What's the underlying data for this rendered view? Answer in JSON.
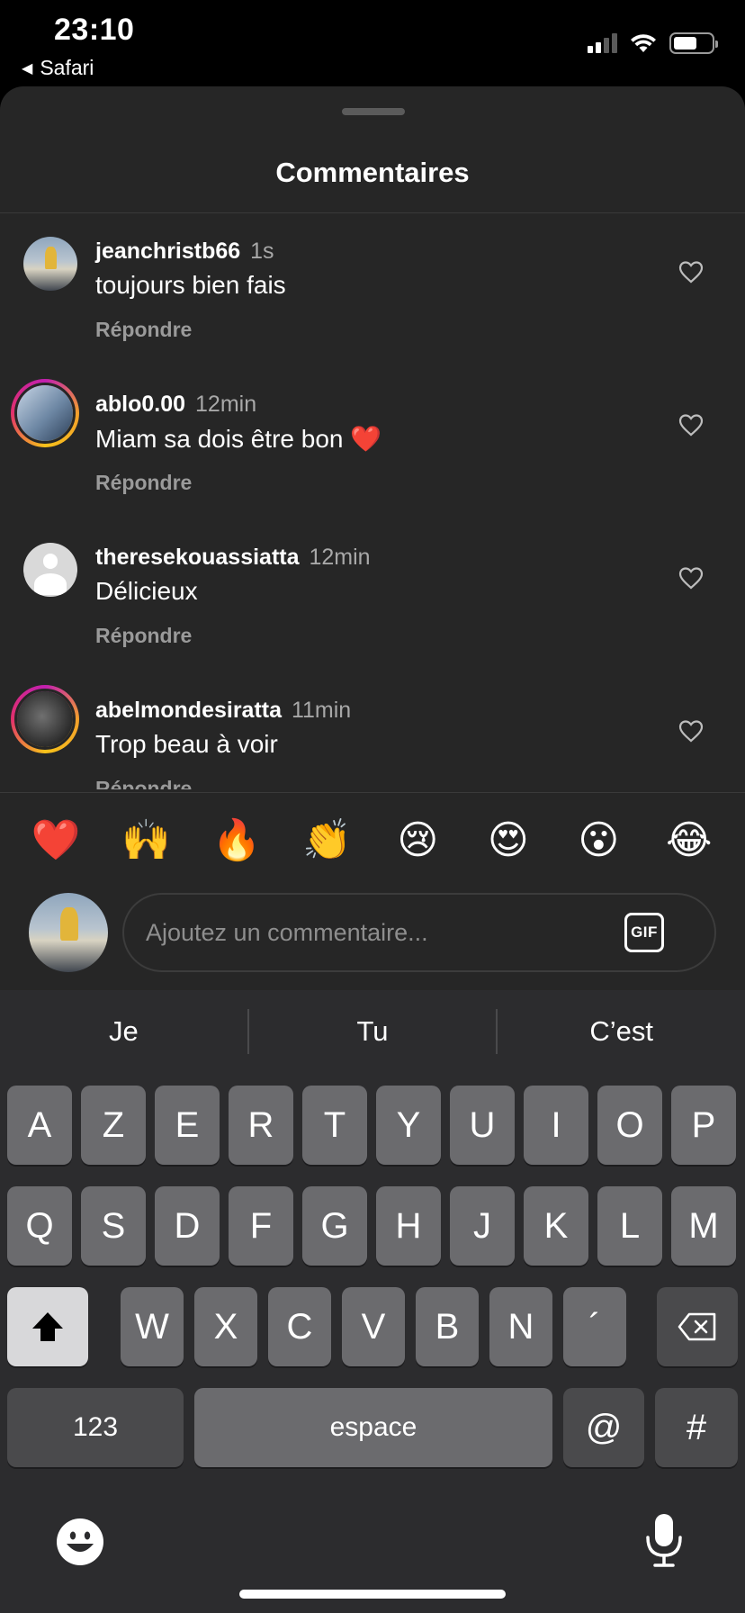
{
  "status_bar": {
    "time": "23:10",
    "back_app": "Safari"
  },
  "sheet": {
    "title": "Commentaires"
  },
  "comments": [
    {
      "user": "jeanchristb66",
      "time": "1s",
      "text": "toujours bien fais",
      "reply": "Répondre"
    },
    {
      "user": "ablo0.00",
      "time": "12min",
      "text": "Miam sa dois être bon ❤️",
      "reply": "Répondre"
    },
    {
      "user": "theresekouassiatta",
      "time": "12min",
      "text": "Délicieux",
      "reply": "Répondre"
    },
    {
      "user": "abelmondesiratta",
      "time": "11min",
      "text": "Trop beau à voir",
      "reply": "Répondre"
    }
  ],
  "quick_emojis": [
    "❤️",
    "🙌",
    "🔥",
    "👏",
    "😢",
    "😍",
    "😮",
    "😂"
  ],
  "composer": {
    "placeholder": "Ajoutez un commentaire...",
    "gif_label": "GIF"
  },
  "keyboard": {
    "suggestions": [
      "Je",
      "Tu",
      "C’est"
    ],
    "row1": [
      "A",
      "Z",
      "E",
      "R",
      "T",
      "Y",
      "U",
      "I",
      "O",
      "P"
    ],
    "row2": [
      "Q",
      "S",
      "D",
      "F",
      "G",
      "H",
      "J",
      "K",
      "L",
      "M"
    ],
    "row3": [
      "W",
      "X",
      "C",
      "V",
      "B",
      "N",
      "´"
    ],
    "numbers_label": "123",
    "space_label": "espace",
    "at_label": "@",
    "hash_label": "#"
  },
  "icons": {
    "shift": "shift-icon",
    "delete": "backspace-icon",
    "emoji": "emoji-keyboard-icon",
    "mic": "microphone-icon",
    "like": "heart-outline-icon"
  }
}
